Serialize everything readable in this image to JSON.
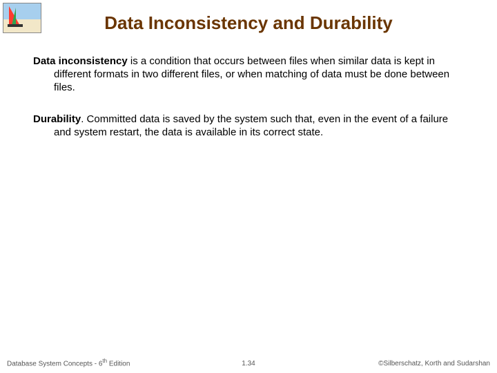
{
  "title": "Data Inconsistency and Durability",
  "paragraphs": [
    {
      "term": "Data inconsistency",
      "rest": " is a condition that occurs between files when similar data is kept in different formats in two different files, or when matching of data must be done between files."
    },
    {
      "term": "Durability",
      "rest": ". Committed data is saved by the system such that, even in the event of a failure and system restart, the data is available in its correct state."
    }
  ],
  "footer": {
    "book_prefix": "Database System Concepts - 6",
    "book_suffix": " Edition",
    "ordinal": "th",
    "page": "1.34",
    "copyright": "©Silberschatz, Korth and Sudarshan"
  }
}
